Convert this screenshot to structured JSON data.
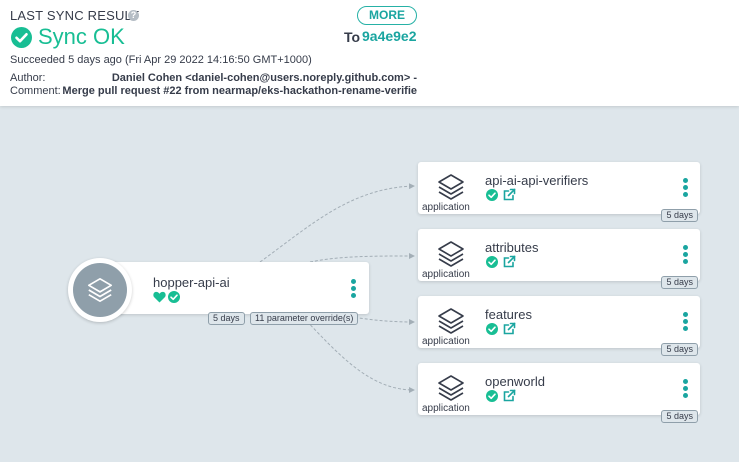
{
  "sync": {
    "title": "LAST SYNC RESULT",
    "help_icon": "question-circle-icon",
    "more_label": "MORE",
    "status": "Sync OK",
    "to_label": "To",
    "revision": "9a4e9e2",
    "succeeded": "Succeeded 5 days ago (Fri Apr 29 2022 14:16:50 GMT+1000)",
    "author_label": "Author:",
    "author_value": "Daniel Cohen <daniel-cohen@users.noreply.github.com> -",
    "comment_label": "Comment:",
    "comment_value": "Merge pull request #22 from nearmap/eks-hackathon-rename-verifie"
  },
  "root": {
    "name": "hopper-api-ai",
    "age": "5 days",
    "overrides": "11 parameter override(s)",
    "health_icon": "heart-icon",
    "sync_icon": "check-circle-icon"
  },
  "apps": [
    {
      "name": "api-ai-api-verifiers",
      "kind": "application",
      "age": "5 days"
    },
    {
      "name": "attributes",
      "kind": "application",
      "age": "5 days"
    },
    {
      "name": "features",
      "kind": "application",
      "age": "5 days"
    },
    {
      "name": "openworld",
      "kind": "application",
      "age": "5 days"
    }
  ],
  "colors": {
    "accent": "#1aa5a0",
    "success": "#18be94",
    "background": "#dee6eb",
    "icon_gray": "#8f9faa"
  }
}
